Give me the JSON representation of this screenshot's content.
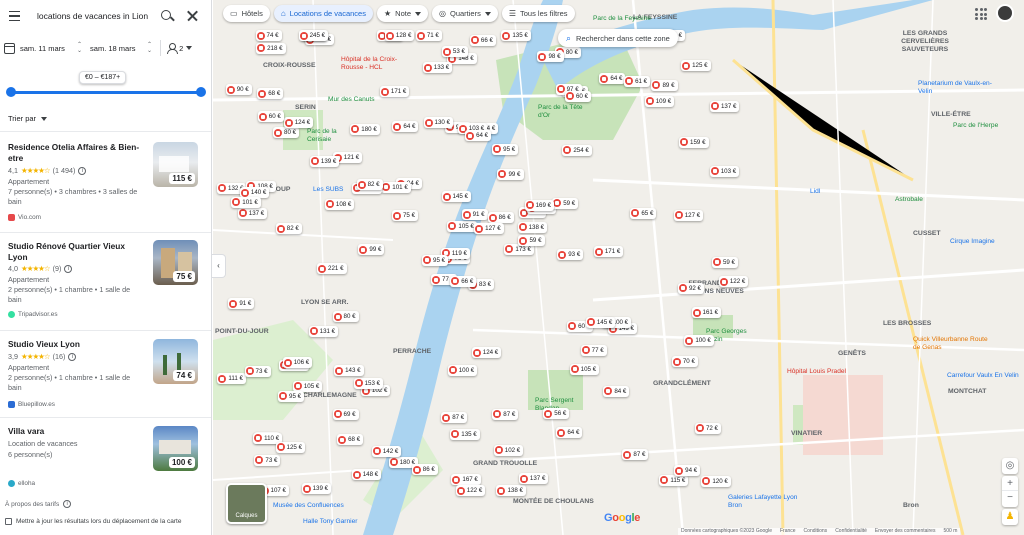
{
  "search": {
    "query": "locations de vacances in Lion"
  },
  "dates": {
    "checkin": "sam. 11 mars",
    "checkout": "sam. 18 mars",
    "guests": "2"
  },
  "price_range": {
    "label": "€0 – €187+"
  },
  "sort": {
    "label": "Trier par"
  },
  "results": [
    {
      "title": "Residence Otelia Affaires & Bien-etre",
      "rating": "4,1",
      "stars": "★★★★☆",
      "reviews": "(1 494)",
      "type": "Appartement",
      "details": "7 personne(s) • 3 chambres • 3 salles de bain",
      "source": "Vio.com",
      "source_color": "#e6494b",
      "price": "115 €"
    },
    {
      "title": "Studio Rénové Quartier Vieux Lyon",
      "rating": "4,0",
      "stars": "★★★★☆",
      "reviews": "(9)",
      "type": "Appartement",
      "details": "2 personne(s) • 1 chambre • 1 salle de bain",
      "source": "Tripadvisor.es",
      "source_color": "#34e0a1",
      "price": "75 €"
    },
    {
      "title": "Studio Vieux Lyon",
      "rating": "3,9",
      "stars": "★★★★☆",
      "reviews": "(16)",
      "type": "Appartement",
      "details": "2 personne(s) • 1 chambre • 1 salle de bain",
      "source": "Bluepillow.es",
      "source_color": "#2b6cd4",
      "price": "74 €"
    },
    {
      "title": "Villa vara",
      "rating": "",
      "stars": "",
      "reviews": "",
      "type": "Location de vacances",
      "details": "6 personne(s)",
      "source": "elloha",
      "source_color": "#2aa9c9",
      "price": "100 €"
    }
  ],
  "footer": {
    "about": "À propos des tarifs",
    "update": "Mettre à jour les résultats lors du déplacement de la carte"
  },
  "chips": [
    {
      "label": "Hôtels",
      "icon": "bed-icon"
    },
    {
      "label": "Locations de vacances",
      "icon": "house-icon"
    },
    {
      "label": "Note",
      "icon": "star-icon"
    },
    {
      "label": "Quartiers",
      "icon": "target-icon"
    },
    {
      "label": "Tous les filtres",
      "icon": "sliders-icon"
    }
  ],
  "map": {
    "search_area": "Rechercher dans cette zone",
    "layers": "Calques",
    "attribution": [
      "Données cartographiques ©2023 Google",
      "France",
      "Conditions",
      "Confidentialité",
      "Envoyer des commentaires",
      "500 m"
    ],
    "labels": [
      "CROIX-ROUSSE",
      "SERIN",
      "GORGE DE LOUP",
      "LYON SE ARR.",
      "POINT-DU-JOUR",
      "PERRACHE",
      "CHARLEMAGNE",
      "MONTÉE DE CHOULANS",
      "GRAND TROUOLLE",
      "FERRANDIÈRE MAISONS NEUVES",
      "GRANDCLÉMENT",
      "CUSSET",
      "GENÊTS",
      "LES BROSSES",
      "VINATIER",
      "Bron",
      "LA FEYSSINE",
      "LES GRANDS CERVELIÈRES SAUVETEURS",
      "MONTCHAT",
      "VILLE-ÉTRE"
    ],
    "pois": [
      "Mur des Canuts",
      "Hôpital de la Croix-Rousse - HCL",
      "Parc de la Tête d'Or",
      "Parc de la Cerisaie",
      "Astrobale",
      "Cirque Imagine",
      "Parc Georges Bazin",
      "Hôpital Louis Pradel",
      "Quick Villeurbanne Route de Genas",
      "Carrefour Vaulx En Velin",
      "Parc Sergent Blandan",
      "Galeries Lafayette Lyon Bron",
      "Les SUBS",
      "Planetarium de Vaulx-en-Velin",
      "Lidl",
      "Musée des Confluences",
      "Halle Tony Garnier",
      "Parc de l'Herpe",
      "Parc de la Feyssine"
    ],
    "prices": [
      "83 €",
      "80 €",
      "76 €",
      "66 €",
      "70 €",
      "102 €",
      "80 €",
      "74 €",
      "78 €",
      "173 €",
      "144 €",
      "120 €",
      "82 €",
      "137 €",
      "77 €",
      "254 €",
      "139 €",
      "99 €",
      "99 €",
      "105 €",
      "84 €",
      "73 €",
      "68 €",
      "103 €",
      "130 €",
      "149 €",
      "124 €",
      "148 €",
      "137 €",
      "60 €",
      "103 €",
      "119 €",
      "87 €",
      "105 €",
      "180 €",
      "64 €",
      "153 €",
      "115 €",
      "72 €",
      "100 €",
      "135 €",
      "101 €",
      "108 €",
      "105 €",
      "148 €",
      "132 €",
      "138 €",
      "107 €",
      "135 €",
      "59 €",
      "95 €",
      "159 €",
      "90 €",
      "77 €",
      "64 €",
      "69 €",
      "58 €",
      "74 €",
      "87 €",
      "89 €",
      "66 €",
      "99 €",
      "108 €",
      "121 €",
      "61 €",
      "245 €",
      "98 €",
      "133 €",
      "91 €",
      "111 €",
      "100 €",
      "180 €",
      "145 €",
      "171 €",
      "110 €",
      "218 €",
      "139 €",
      "91 €",
      "145 €",
      "102 €",
      "86 €",
      "125 €",
      "93 €",
      "100 €",
      "167 €",
      "127 €",
      "124 €",
      "87 €",
      "138 €",
      "56 €",
      "53 €",
      "122 €",
      "59 €",
      "84 €",
      "127 €",
      "70 €",
      "140 €",
      "122 €",
      "97 €",
      "60 €",
      "221 €",
      "94 €",
      "59 €",
      "101 €",
      "131 €",
      "143 €",
      "142 €",
      "169 €",
      "109 €",
      "75 €",
      "92 €",
      "68 €",
      "64 €",
      "95 €",
      "128 €",
      "73 €",
      "66 €",
      "125 €",
      "130 €",
      "71 €",
      "155 €",
      "121 €",
      "95 €",
      "64 €",
      "171 €",
      "80 €",
      "94 €",
      "86 €",
      "65 €",
      "60 €",
      "106 €",
      "137 €",
      "82 €",
      "171 €",
      "161 €"
    ]
  }
}
